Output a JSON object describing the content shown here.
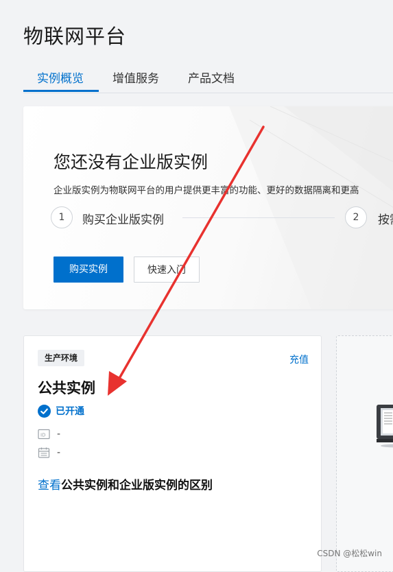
{
  "app": {
    "title": "物联网平台"
  },
  "tabs": [
    {
      "label": "实例概览",
      "active": true
    },
    {
      "label": "增值服务",
      "active": false
    },
    {
      "label": "产品文档",
      "active": false
    }
  ],
  "hero": {
    "title": "您还没有企业版实例",
    "description": "企业版实例为物联网平台的用户提供更丰富的功能、更好的数据隔离和更高",
    "steps": [
      {
        "number": "1",
        "label": "购买企业版实例"
      },
      {
        "number": "2",
        "label": "按需"
      }
    ],
    "buy_button": "购买实例",
    "quickstart_button": "快速入门"
  },
  "public_instance": {
    "env_badge": "生产环境",
    "recharge_link": "充值",
    "title": "公共实例",
    "status": "已开通",
    "id_value": "-",
    "date_value": "-",
    "compare_link": "查看",
    "compare_text": "公共实例和企业版实例的区别"
  },
  "watermark": "CSDN @松松win",
  "colors": {
    "accent": "#0070cc",
    "annotation_arrow": "#e8322f",
    "background": "#f2f3f5"
  },
  "icons": [
    "check-circle-icon",
    "id-icon",
    "calendar-icon",
    "monitor-icon",
    "red-arrow"
  ]
}
